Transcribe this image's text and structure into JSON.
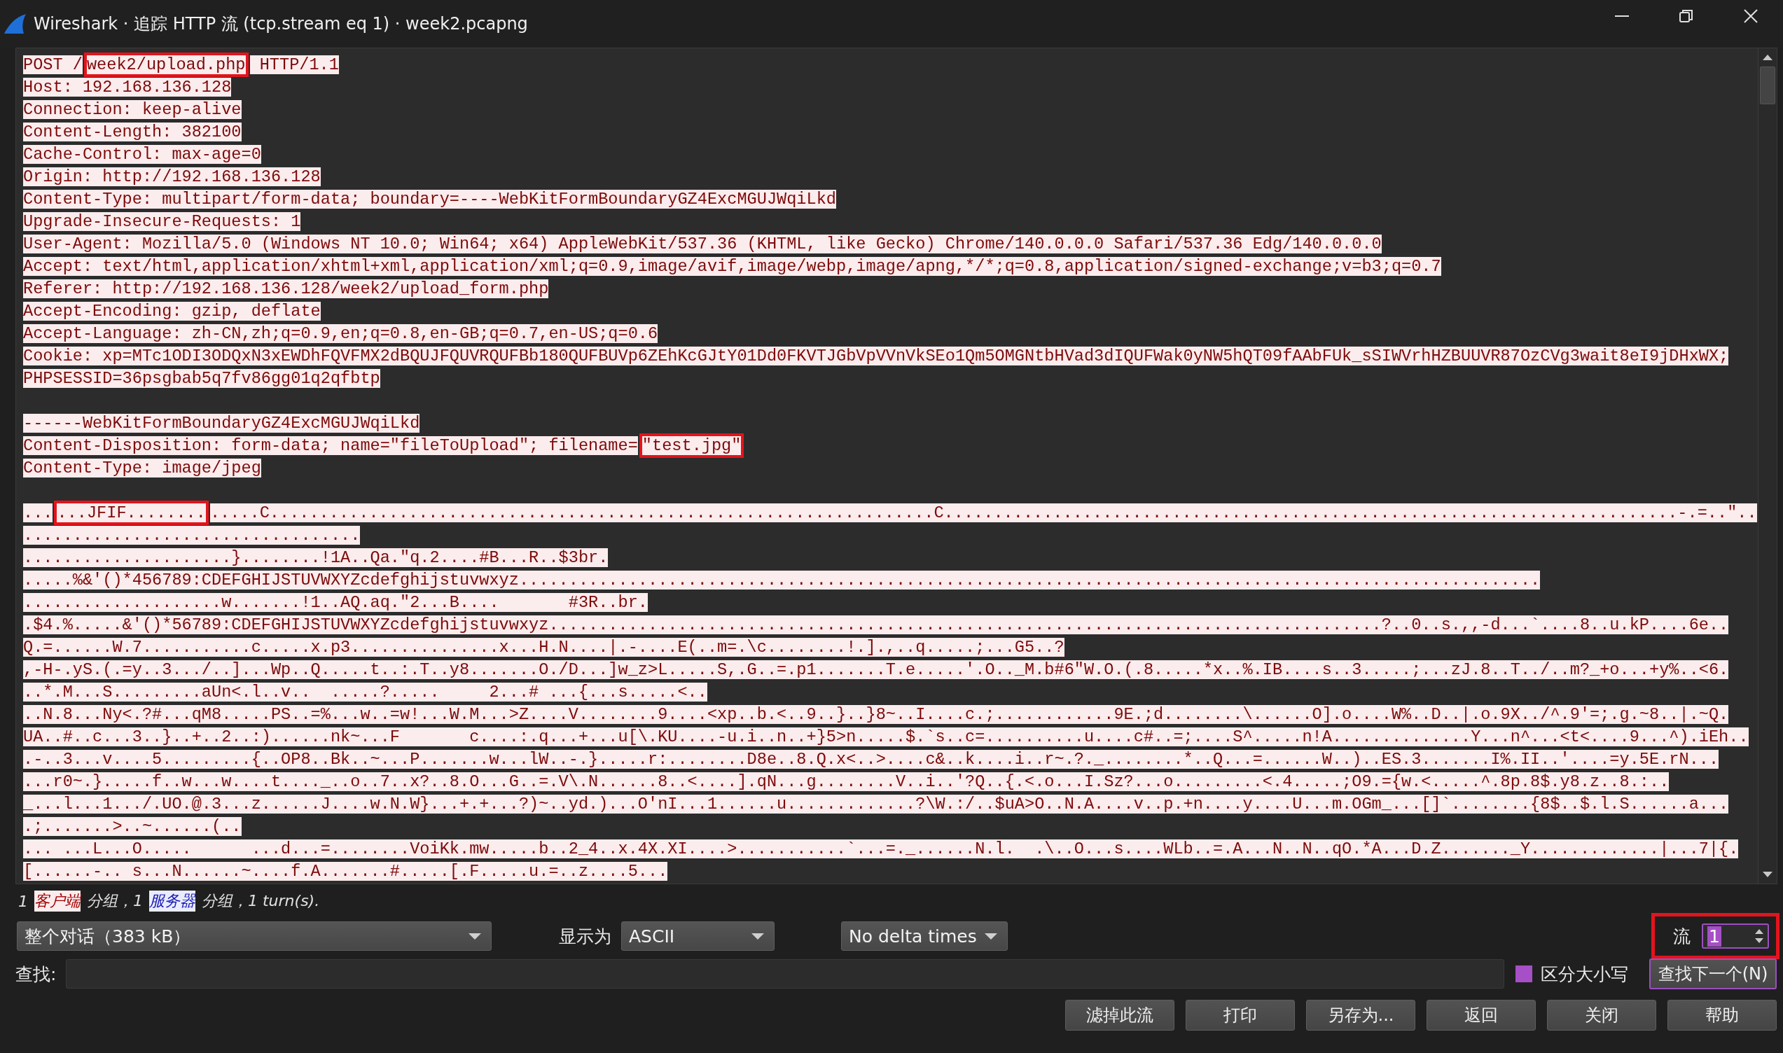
{
  "window": {
    "title": "Wireshark · 追踪 HTTP 流 (tcp.stream eq 1) · week2.pcapng"
  },
  "stream_lines": [
    {
      "kind": "text",
      "segments": [
        {
          "text": "POST /",
          "marked": false
        },
        {
          "text": "week2/upload.php",
          "marked": true
        },
        {
          "text": " HTTP/1.1",
          "marked": false
        }
      ]
    },
    {
      "kind": "text",
      "segments": [
        {
          "text": "Host: 192.168.136.128",
          "marked": false
        }
      ]
    },
    {
      "kind": "text",
      "segments": [
        {
          "text": "Connection: keep-alive",
          "marked": false
        }
      ]
    },
    {
      "kind": "text",
      "segments": [
        {
          "text": "Content-Length: 382100",
          "marked": false
        }
      ]
    },
    {
      "kind": "text",
      "segments": [
        {
          "text": "Cache-Control: max-age=0",
          "marked": false
        }
      ]
    },
    {
      "kind": "text",
      "segments": [
        {
          "text": "Origin: http://192.168.136.128",
          "marked": false
        }
      ]
    },
    {
      "kind": "text",
      "segments": [
        {
          "text": "Content-Type: multipart/form-data; boundary=----WebKitFormBoundaryGZ4ExcMGUJWqiLkd",
          "marked": false
        }
      ]
    },
    {
      "kind": "text",
      "segments": [
        {
          "text": "Upgrade-Insecure-Requests: 1",
          "marked": false
        }
      ]
    },
    {
      "kind": "text",
      "segments": [
        {
          "text": "User-Agent: Mozilla/5.0 (Windows NT 10.0; Win64; x64) AppleWebKit/537.36 (KHTML, like Gecko) Chrome/140.0.0.0 Safari/537.36 Edg/140.0.0.0",
          "marked": false
        }
      ]
    },
    {
      "kind": "text",
      "segments": [
        {
          "text": "Accept: text/html,application/xhtml+xml,application/xml;q=0.9,image/avif,image/webp,image/apng,*/*;q=0.8,application/signed-exchange;v=b3;q=0.7",
          "marked": false
        }
      ]
    },
    {
      "kind": "text",
      "segments": [
        {
          "text": "Referer: http://192.168.136.128/week2/upload_form.php",
          "marked": false
        }
      ]
    },
    {
      "kind": "text",
      "segments": [
        {
          "text": "Accept-Encoding: gzip, deflate",
          "marked": false
        }
      ]
    },
    {
      "kind": "text",
      "segments": [
        {
          "text": "Accept-Language: zh-CN,zh;q=0.9,en;q=0.8,en-GB;q=0.7,en-US;q=0.6",
          "marked": false
        }
      ]
    },
    {
      "kind": "text",
      "segments": [
        {
          "text": "Cookie: xp=MTc1ODI3ODQxN3xEWDhFQVFMX2dBQUJFQUVRQUFBb180QUFBUVp6ZEhKcGJtY01Dd0FKVTJGbVpVVnVkSEo1Qm5OMGNtbHVad3dIQUFWak0yNW5hQT09fAAbFUk_sSIWVrhHZBUUVR87OzCVg3wait8eI9jDHxWX;",
          "marked": false
        }
      ]
    },
    {
      "kind": "text",
      "segments": [
        {
          "text": "PHPSESSID=36psgbab5q7fv86gg01q2qfbtp",
          "marked": false
        }
      ]
    },
    {
      "kind": "blank"
    },
    {
      "kind": "text",
      "segments": [
        {
          "text": "------WebKitFormBoundaryGZ4ExcMGUJWqiLkd",
          "marked": false
        }
      ]
    },
    {
      "kind": "text",
      "segments": [
        {
          "text": "Content-Disposition: form-data; name=\"fileToUpload\"; filename=",
          "marked": false
        },
        {
          "text": "\"test.jpg\"",
          "marked": true
        }
      ]
    },
    {
      "kind": "text",
      "segments": [
        {
          "text": "Content-Type: image/jpeg",
          "marked": false
        }
      ]
    },
    {
      "kind": "blank"
    },
    {
      "kind": "text",
      "segments": [
        {
          "text": "...",
          "marked": false
        },
        {
          "text": "...JFIF........",
          "marked": true
        },
        {
          "text": ".....C...................................................................C..........................................................................-.=..\"..",
          "marked": false
        }
      ]
    },
    {
      "kind": "text",
      "segments": [
        {
          "text": "..................................",
          "marked": false
        }
      ]
    },
    {
      "kind": "text",
      "segments": [
        {
          "text": ".....................}........!1A..Qa.\"q.2....#B...R..$3br.",
          "marked": false
        }
      ]
    },
    {
      "kind": "text",
      "segments": [
        {
          "text": ".....%&'()*456789:CDEFGHIJSTUVWXYZcdefghijstuvwxyz.......................................................................................................",
          "marked": false
        }
      ]
    },
    {
      "kind": "text",
      "segments": [
        {
          "text": "....................w.......!1..AQ.aq.\"2...B....       #3R..br.",
          "marked": false
        }
      ]
    },
    {
      "kind": "text",
      "segments": [
        {
          "text": ".$4.%.....&'()*56789:CDEFGHIJSTUVWXYZcdefghijstuvwxyz....................................................................................?..0..s.,,-d...`....8..u.kP....6e..",
          "marked": false
        }
      ]
    },
    {
      "kind": "text",
      "segments": [
        {
          "text": "Q.=......W.7...........c.....x.p3...............x...H.N....|.-....E(..m=.\\c........!.].,..q.....;...G5..?",
          "marked": false
        }
      ]
    },
    {
      "kind": "text",
      "segments": [
        {
          "text": ",-H-.yS.(.=y..3.../..]...Wp..Q.....t..:.T..y8.......O./D...]w_z>L.....S,.G..=.p1.......T.e.....'.O.._M.b#6\"W.O.(.8.....*x..%.IB....s..3.....;...zJ.8..T../..m?_+o...+y%..<6.",
          "marked": false
        }
      ]
    },
    {
      "kind": "text",
      "segments": [
        {
          "text": "..*.M...S.........aUn<.l..v..  .....?.....     2...# ...{...s.....<..",
          "marked": false
        }
      ]
    },
    {
      "kind": "text",
      "segments": [
        {
          "text": "..N.8...Ny<.?#...qM8.....PS..=%...w..=w!...W.M...>Z....V........9....<xp..b.<..9..}..}8~..I....c.;............9E.;d........\\......O].o....W%..D..|.o.9X../^.9'=;.g.~8..|.~Q.",
          "marked": false
        }
      ]
    },
    {
      "kind": "text",
      "segments": [
        {
          "text": "UA..#..c...3..}..+..2..:)......nk~...F       c....:.q...+...u[\\.KU....-u.i..n..+}5>n.....$.`s..c=..........u....c#..=;....S^.....n!A..............Y...n^...<t<....9...^).iEh..",
          "marked": false
        }
      ]
    },
    {
      "kind": "text",
      "segments": [
        {
          "text": ".-..3...v....5.........{..OP8..Bk..~...P.......w...lW..-.}.....r:........D8e..8.Q.x<..>....c&..k....i..r~.?._........*..Q...=......W..)..ES.3.......I%.II..'....=y.5E.rN...",
          "marked": false
        }
      ]
    },
    {
      "kind": "text",
      "segments": [
        {
          "text": "...r0~.}.....f..w...w....t...._..o..7..x?..8.O...G..=.V\\.N......8..<....].qN...g........V..i..'?Q..{.<.o...I.Sz?...o.........<.4.....;O9.={w.<.....^.8p.8$.y8.z..8.:..",
          "marked": false
        }
      ]
    },
    {
      "kind": "text",
      "segments": [
        {
          "text": "_...l...1.../.UO.@.3...z......J....w.N.W}...+.+...?)~..yd.)...O'nI...1......u.............?\\W.:/..$uA>O..N.A....v..p.+n....y....U...m.OGm_...[]`........{8$..$.l.S......a...",
          "marked": false
        }
      ]
    },
    {
      "kind": "text",
      "segments": [
        {
          "text": ".;.......>..~......(..",
          "marked": false
        }
      ]
    },
    {
      "kind": "text",
      "segments": [
        {
          "text": "... ...L...O.....      ...d...=........VoiKk.mw.....b..2_4..x.4X.XI....>...........`...=._......N.l.  .\\..O...s....WLb..=.A...N..N..qO.*A...D.Z......._Y.............|...7|{.",
          "marked": false
        }
      ]
    },
    {
      "kind": "text",
      "segments": [
        {
          "text": "[......-.. s...N......~....f.A.......#.....[.F.....u.=..z....5...",
          "marked": false
        }
      ]
    }
  ],
  "summary": {
    "segments": [
      {
        "text": "1",
        "kind": "plain"
      },
      {
        "text": "客户端",
        "kind": "client"
      },
      {
        "text": "分组，1",
        "kind": "plain"
      },
      {
        "text": "服务器",
        "kind": "server"
      },
      {
        "text": "分组，1 turn(s).",
        "kind": "plain"
      }
    ]
  },
  "conversation_select": {
    "value": "整个对话（383 kB）"
  },
  "show_as": {
    "label": "显示为",
    "value": "ASCII"
  },
  "delta_select": {
    "value": "No delta times"
  },
  "stream": {
    "label": "流",
    "value": "1",
    "marked": true
  },
  "find": {
    "label": "查找:"
  },
  "case_sensitive": {
    "label": "区分大小写",
    "checked": true
  },
  "find_next": {
    "label": "查找下一个(N)"
  },
  "buttons": [
    "滤掉此流",
    "打印",
    "另存为...",
    "返回",
    "关闭",
    "帮助"
  ]
}
